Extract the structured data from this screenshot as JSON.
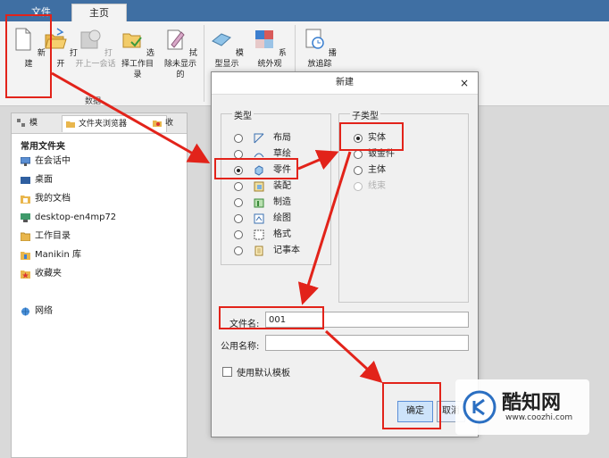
{
  "ribbon": {
    "tabs": [
      {
        "label": "文件"
      },
      {
        "label": "主页"
      }
    ],
    "buttons": [
      {
        "label": "新建"
      },
      {
        "label": "打开"
      },
      {
        "label": "打开上一会话"
      },
      {
        "label": "选择工作目录"
      },
      {
        "label": "拭除未显示的"
      },
      {
        "label": "模型显示"
      },
      {
        "label": "系统外观"
      },
      {
        "label": "播放追踪"
      }
    ],
    "group_label": "数据"
  },
  "left_panel": {
    "tabs": [
      {
        "label": "模"
      },
      {
        "label": "文件夹浏览器"
      },
      {
        "label": "收"
      }
    ],
    "title": "常用文件夹",
    "items": [
      {
        "label": "在会话中",
        "icon": "monitor-icon"
      },
      {
        "label": "桌面",
        "icon": "desktop-icon"
      },
      {
        "label": "我的文档",
        "icon": "documents-icon"
      },
      {
        "label": "desktop-en4mp72",
        "icon": "computer-icon"
      },
      {
        "label": "工作目录",
        "icon": "folder-icon"
      },
      {
        "label": "Manikin 库",
        "icon": "library-icon"
      },
      {
        "label": "收藏夹",
        "icon": "favorites-icon"
      },
      {
        "label": "网络",
        "icon": "network-icon"
      }
    ]
  },
  "dialog": {
    "title": "新建",
    "close": "×",
    "type_legend": "类型",
    "types": [
      {
        "label": "布局",
        "selected": false
      },
      {
        "label": "草绘",
        "selected": false
      },
      {
        "label": "零件",
        "selected": true
      },
      {
        "label": "装配",
        "selected": false
      },
      {
        "label": "制造",
        "selected": false
      },
      {
        "label": "绘图",
        "selected": false
      },
      {
        "label": "格式",
        "selected": false
      },
      {
        "label": "记事本",
        "selected": false
      }
    ],
    "subtype_legend": "子类型",
    "subtypes": [
      {
        "label": "实体",
        "selected": true,
        "disabled": false
      },
      {
        "label": "钣金件",
        "selected": false,
        "disabled": false
      },
      {
        "label": "主体",
        "selected": false,
        "disabled": false
      },
      {
        "label": "线束",
        "selected": false,
        "disabled": true
      }
    ],
    "filename_label": "文件名:",
    "filename_value": "001",
    "common_name_label": "公用名称:",
    "common_name_value": "",
    "use_default_template": "使用默认模板",
    "ok": "确定",
    "cancel": "取消"
  },
  "watermark": {
    "name": "酷知网",
    "url": "www.coozhi.com"
  },
  "colors": {
    "highlight": "#e2231a",
    "ribbon_blue": "#3f6fa3",
    "dialog_bg": "#f0f0f0"
  }
}
